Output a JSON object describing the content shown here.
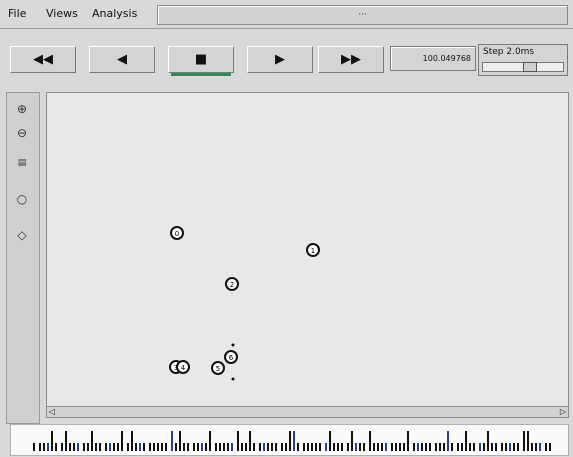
{
  "menubar": {
    "items": [
      {
        "label": "File"
      },
      {
        "label": "Views"
      },
      {
        "label": "Analysis"
      }
    ],
    "title": "···"
  },
  "toolbar": {
    "rewind_label": "◀◀",
    "back_label": "◀",
    "stop_label": "■",
    "play_label": "▶",
    "ff_label": "▶▶",
    "time": "100.049768",
    "step_label": "Step 2.0ms",
    "step_value": 0.6
  },
  "leftbar": {
    "icons": [
      "zoom-in-icon",
      "zoom-out-icon",
      "grid-icon",
      "node-icon",
      "link-icon"
    ]
  },
  "scroll": {
    "left_label": "◁",
    "right_label": "▷"
  },
  "nodes": [
    {
      "id": "0"
    },
    {
      "id": "1"
    },
    {
      "id": "2"
    },
    {
      "id": "3"
    },
    {
      "id": "4"
    },
    {
      "id": "5"
    },
    {
      "id": "6"
    }
  ]
}
